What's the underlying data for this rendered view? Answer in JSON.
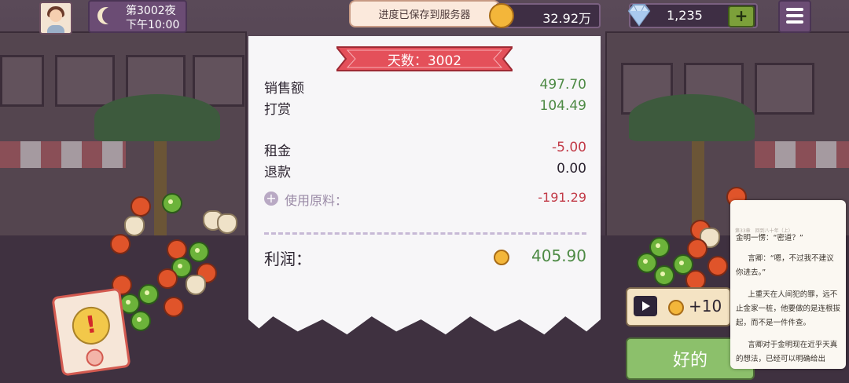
{
  "topbar": {
    "day_label": "第3002夜",
    "time_label": "下午10:00",
    "save_toast": "进度已保存到服务器",
    "coins": "32.92万",
    "gems": "1,235",
    "add_label": "+"
  },
  "receipt": {
    "banner": "天数：3002",
    "sales_label": "销售额",
    "sales_value": "497.70",
    "tips_label": "打赏",
    "tips_value": "104.49",
    "rent_label": "租金",
    "rent_value": "-5.00",
    "refund_label": "退款",
    "refund_value": "0.00",
    "materials_label": "使用原料：",
    "materials_value": "-191.29",
    "profit_label": "利润：",
    "profit_value": "405.90"
  },
  "actions": {
    "ad_reward": "+10",
    "ok_label": "好的",
    "alert_symbol": "!"
  },
  "reader": {
    "header": "第33章　回到八十年（上）",
    "lines": [
      "金明一愣：“密道？”",
      "言卿：“嗯，不过我不建议你进去。”",
      "上重天在人间犯的罪，远不止金家一桩，他要做的是连根拔起，而不是一件件查。",
      "言卿对于金明现在近乎天真的想法，已经可以明确给出"
    ]
  },
  "colors": {
    "profit_green": "#4d8a44",
    "loss_red": "#c23b48",
    "banner_red": "#e4505a",
    "ok_green": "#8cc06b"
  }
}
